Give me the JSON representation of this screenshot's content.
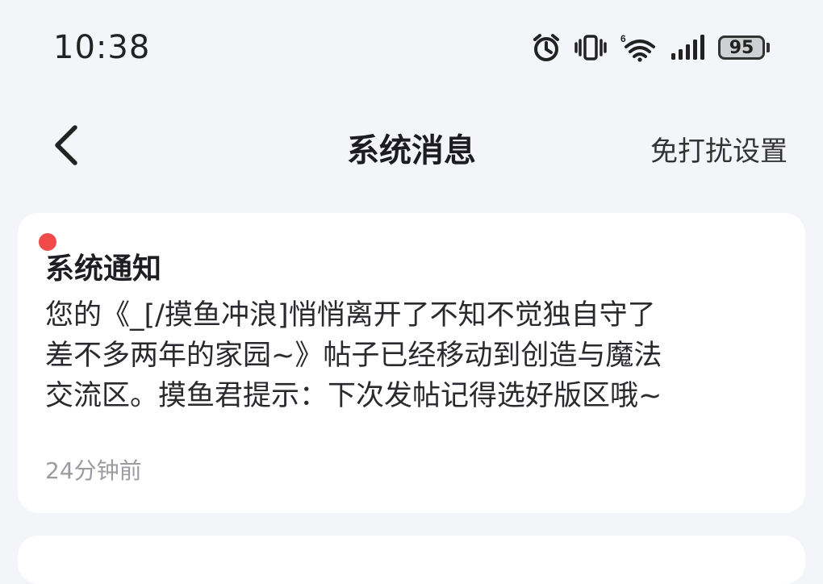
{
  "status_bar": {
    "time": "10:38",
    "battery_level": "95",
    "wifi_badge": "6",
    "icons": [
      "alarm-icon",
      "vibrate-icon",
      "wifi-icon",
      "signal-icon",
      "battery-icon"
    ]
  },
  "header": {
    "back_icon": "chevron-left-icon",
    "title": "系统消息",
    "dnd_settings_label": "免打扰设置"
  },
  "messages": [
    {
      "title": "系统通知",
      "unread": true,
      "body": "您的《_[/摸鱼冲浪]悄悄离开了不知不觉独自守了\n差不多两年的家园~》帖子已经移动到创造与魔法\n交流区。摸鱼君提示：下次发帖记得选好版区哦~",
      "time": "24分钟前"
    }
  ],
  "colors": {
    "background": "#f4f5f9",
    "card": "#ffffff",
    "unread_dot": "#f24a4a",
    "muted_text": "#9b9ba1"
  }
}
